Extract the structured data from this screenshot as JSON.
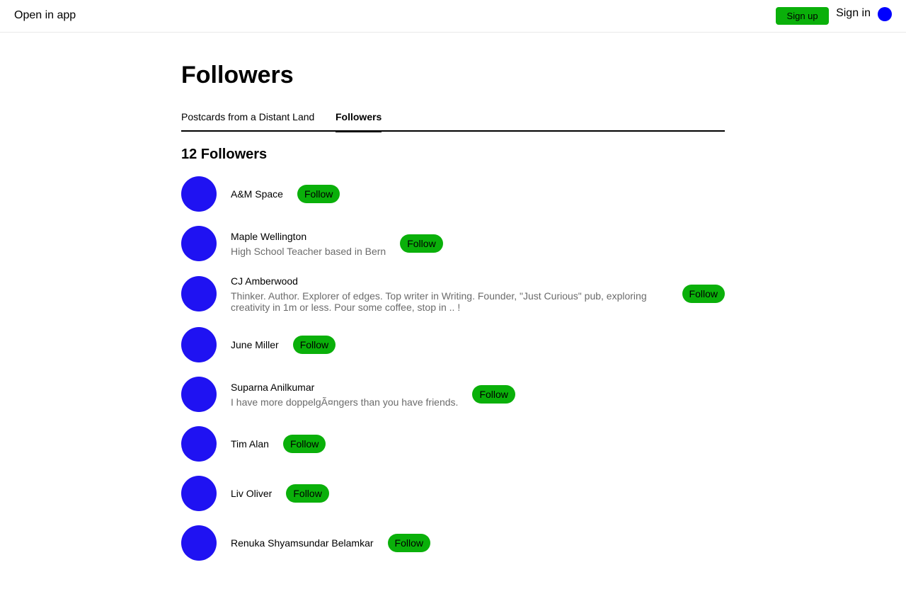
{
  "topbar": {
    "open_in_app": "Open in app",
    "sign_up": "Sign up",
    "sign_in": "Sign in"
  },
  "page": {
    "title": "Followers",
    "tabs": [
      {
        "label": "Postcards from a Distant Land",
        "active": false
      },
      {
        "label": "Followers",
        "active": true
      }
    ],
    "count": "12 Followers"
  },
  "followers": [
    {
      "name": "A&M Space",
      "bio": "",
      "action": "Follow"
    },
    {
      "name": "Maple Wellington",
      "bio": "High School Teacher based in Bern",
      "action": "Follow"
    },
    {
      "name": "CJ Amberwood",
      "bio": "Thinker. Author. Explorer of edges. Top writer in Writing. Founder, \"Just Curious\" pub, exploring creativity in 1m or less. Pour some coffee, stop in .. !",
      "action": "Follow"
    },
    {
      "name": "June Miller",
      "bio": "",
      "action": "Follow"
    },
    {
      "name": "Suparna Anilkumar",
      "bio": "I have more doppelgÃ¤ngers than you have friends.",
      "action": "Follow"
    },
    {
      "name": "Tim Alan",
      "bio": "",
      "action": "Follow"
    },
    {
      "name": "Liv Oliver",
      "bio": "",
      "action": "Follow"
    },
    {
      "name": "Renuka Shyamsundar Belamkar",
      "bio": "",
      "action": "Follow"
    }
  ],
  "colors": {
    "accent_green": "#0ab00a",
    "avatar_blue": "#1f12f2",
    "top_avatar_blue": "#0000ff",
    "bio_gray": "#6b6b6b"
  }
}
